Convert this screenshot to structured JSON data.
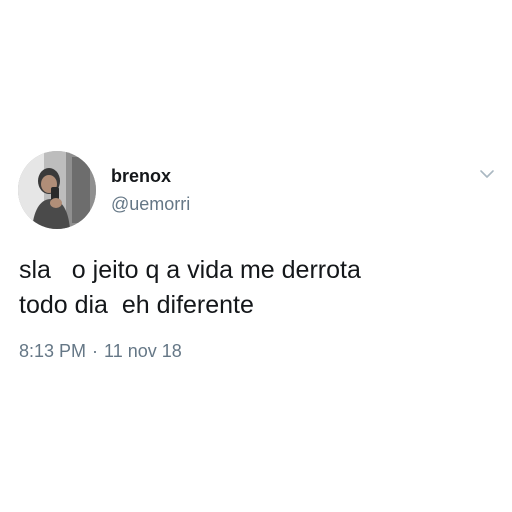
{
  "user": {
    "display_name": "brenox",
    "handle": "@uemorri",
    "avatar_icon": "profile-photo"
  },
  "tweet": {
    "lines": [
      "sla   o jeito q a vida me derrota",
      "todo dia  eh diferente"
    ],
    "time": "8:13 PM",
    "separator": "·",
    "date": "11 nov 18"
  },
  "menu": {
    "icon": "chevron-down-icon"
  },
  "colors": {
    "text": "#14171a",
    "secondary": "#657786",
    "chevron": "#aab8c2"
  }
}
